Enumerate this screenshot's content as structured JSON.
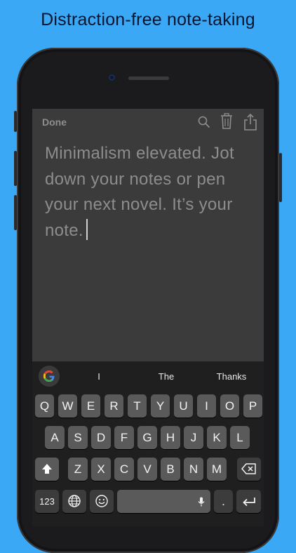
{
  "headline": "Distraction-free note-taking",
  "app": {
    "done_label": "Done",
    "icons": [
      "search-icon",
      "trash-icon",
      "share-icon"
    ],
    "note_body": "Minimalism elevated. Jot down your notes or pen your next novel. It’s your note."
  },
  "keyboard": {
    "suggestions": [
      "I",
      "The",
      "Thanks"
    ],
    "row1": [
      "Q",
      "W",
      "E",
      "R",
      "T",
      "Y",
      "U",
      "I",
      "O",
      "P"
    ],
    "row2": [
      "A",
      "S",
      "D",
      "F",
      "G",
      "H",
      "J",
      "K",
      "L"
    ],
    "row3": [
      "Z",
      "X",
      "C",
      "V",
      "B",
      "N",
      "M"
    ],
    "numbers_label": "123",
    "period_label": ".",
    "icons": [
      "google-icon",
      "shift-icon",
      "backspace-icon",
      "globe-icon",
      "emoji-icon",
      "microphone-icon",
      "return-icon"
    ]
  },
  "colors": {
    "background": "#3aa8f5",
    "headline": "#0a1530",
    "screen": "#3b3b3b",
    "keyboard": "#1f1f1f",
    "key": "#5a5a5a"
  }
}
